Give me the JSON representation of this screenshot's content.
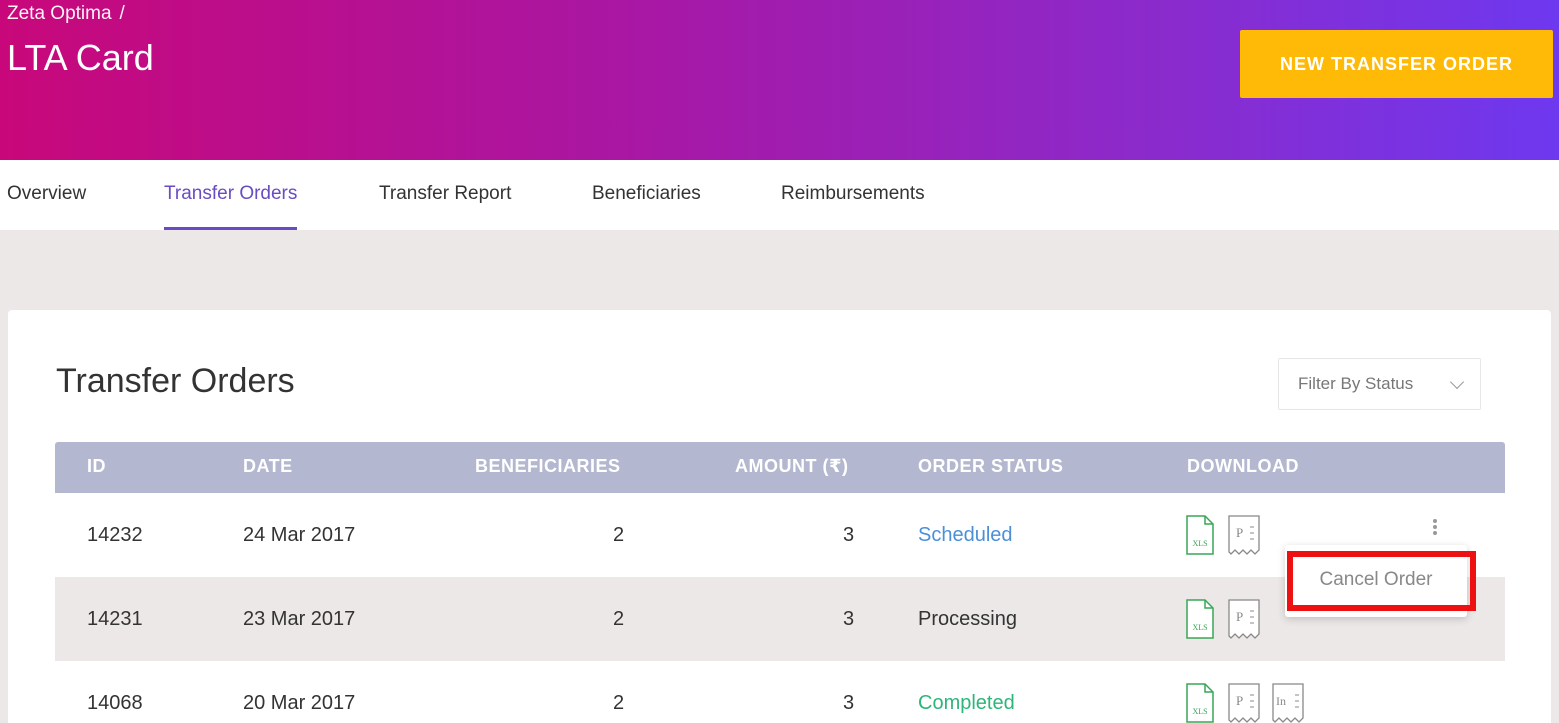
{
  "header": {
    "breadcrumb": "Zeta Optima",
    "breadcrumb_sep": "/",
    "title": "LTA Card",
    "new_button": "NEW TRANSFER ORDER"
  },
  "tabs": [
    {
      "label": "Overview",
      "active": false
    },
    {
      "label": "Transfer Orders",
      "active": true
    },
    {
      "label": "Transfer Report",
      "active": false
    },
    {
      "label": "Beneficiaries",
      "active": false
    },
    {
      "label": "Reimbursements",
      "active": false
    }
  ],
  "card": {
    "title": "Transfer Orders",
    "filter_label": "Filter By Status"
  },
  "table": {
    "columns": [
      "ID",
      "DATE",
      "BENEFICIARIES",
      "AMOUNT (₹)",
      "ORDER STATUS",
      "DOWNLOAD"
    ],
    "rows": [
      {
        "id": "14232",
        "date": "24 Mar 2017",
        "beneficiaries": "2",
        "amount": "3",
        "status": "Scheduled",
        "downloads": [
          "xls-icon",
          "pdf-receipt-icon"
        ]
      },
      {
        "id": "14231",
        "date": "23 Mar 2017",
        "beneficiaries": "2",
        "amount": "3",
        "status": "Processing",
        "downloads": [
          "xls-icon",
          "pdf-receipt-icon"
        ]
      },
      {
        "id": "14068",
        "date": "20 Mar 2017",
        "beneficiaries": "2",
        "amount": "3",
        "status": "Completed",
        "downloads": [
          "xls-icon",
          "pdf-receipt-icon",
          "invoice-receipt-icon"
        ]
      }
    ]
  },
  "dropdown": {
    "item": "Cancel Order"
  },
  "icons": {
    "xls_label": "XLS",
    "pdf_label": "P",
    "invoice_label": "In"
  },
  "colors": {
    "accent": "#6a4bc4",
    "button": "#ffba08",
    "scheduled": "#4a90d9",
    "completed": "#2eb57a",
    "highlight": "#ee1111"
  }
}
